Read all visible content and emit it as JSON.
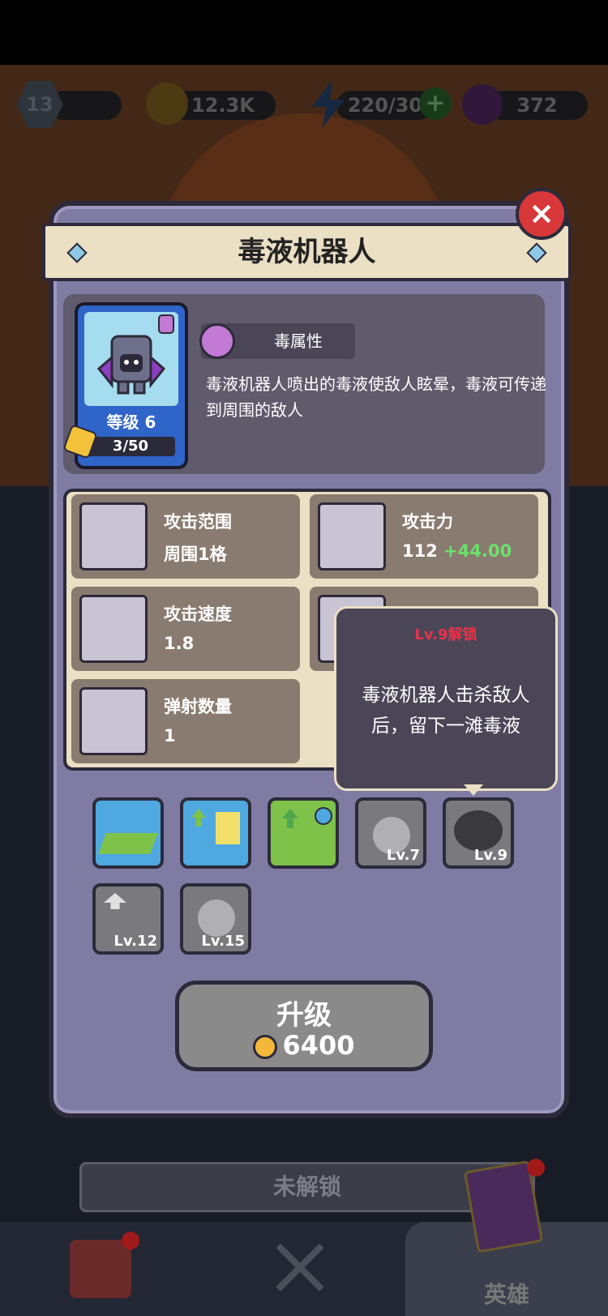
{
  "hud": {
    "player_level": "13",
    "coins": "12.3K",
    "energy": "220/30",
    "gems": "372"
  },
  "modal": {
    "title": "毒液机器人",
    "close_icon": "close-icon"
  },
  "hero": {
    "level_label": "等级 6",
    "shards": "3/50",
    "element": "毒属性",
    "description": "毒液机器人喷出的毒液使敌人眩晕，毒液可传递到周围的敌人"
  },
  "stats": [
    {
      "name": "攻击范围",
      "value": "周围1格",
      "bonus": ""
    },
    {
      "name": "攻击力",
      "value": "112",
      "bonus": "+44.00"
    },
    {
      "name": "攻击速度",
      "value": "1.8",
      "bonus": ""
    },
    {
      "name": "弹射数量",
      "value": "1",
      "bonus": ""
    }
  ],
  "tooltip": {
    "title": "Lv.9解锁",
    "text": "毒液机器人击杀敌人后，留下一滩毒液"
  },
  "skills": [
    {
      "icon": "area-skill-icon",
      "lv": ""
    },
    {
      "icon": "atk-boost-icon",
      "lv": ""
    },
    {
      "icon": "speed-boost-icon",
      "lv": ""
    },
    {
      "icon": "stun-skill-icon",
      "lv": "Lv.7"
    },
    {
      "icon": "poison-puddle-icon",
      "lv": "Lv.9"
    },
    {
      "icon": "range-boost-icon",
      "lv": "Lv.12"
    },
    {
      "icon": "hp-boost-icon",
      "lv": "Lv.15"
    }
  ],
  "upgrade": {
    "label": "升级",
    "cost": "6400"
  },
  "unlock_bar": "未解锁",
  "nav": {
    "heroes_label": "英雄"
  }
}
